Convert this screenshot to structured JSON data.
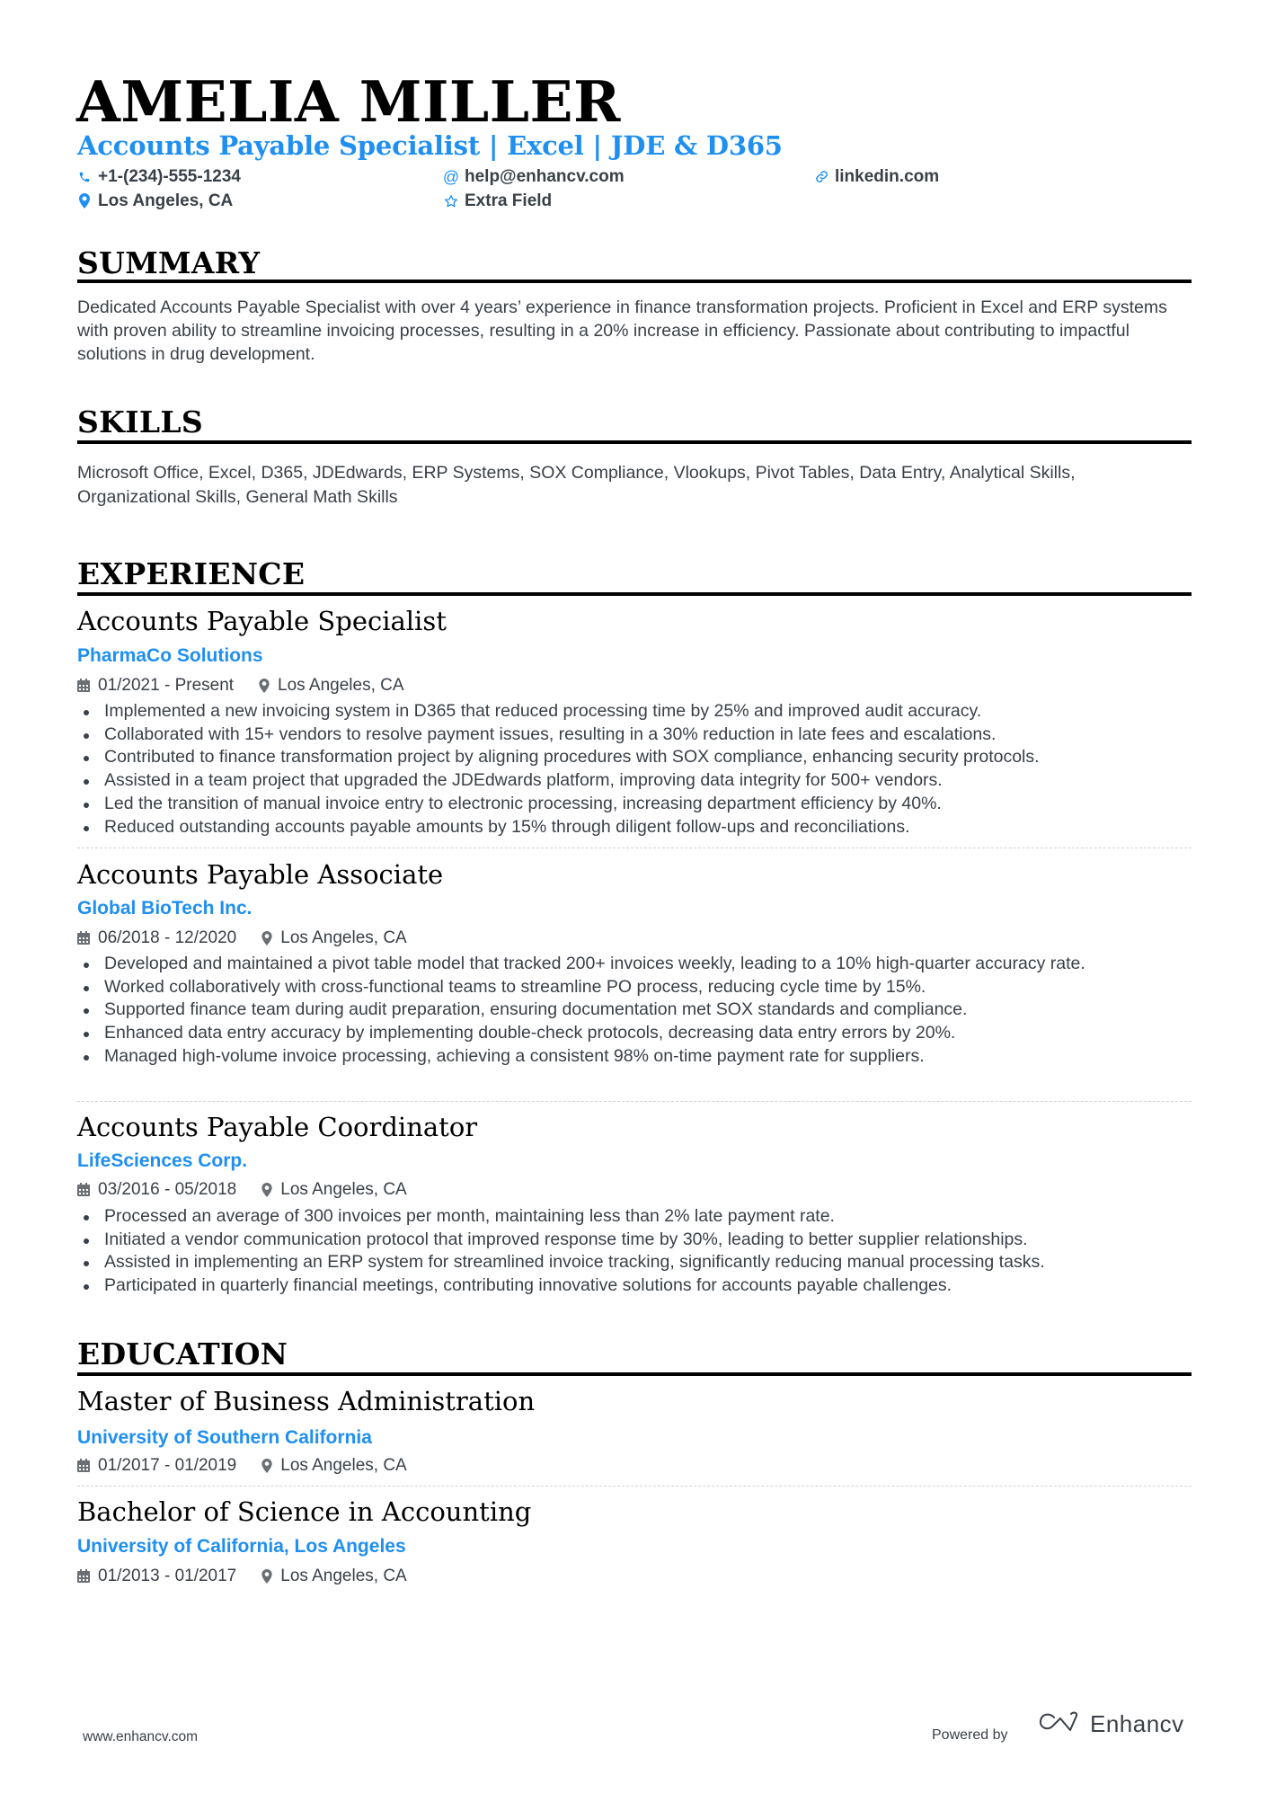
{
  "header": {
    "name": "AMELIA MILLER",
    "subtitle": "Accounts Payable Specialist | Excel | JDE & D365",
    "contacts": {
      "phone": {
        "icon": "phone-icon",
        "text": "+1-(234)-555-1234"
      },
      "email": {
        "icon": "at-icon",
        "text": "help@enhancv.com"
      },
      "linkedin": {
        "icon": "link-icon",
        "text": "linkedin.com"
      },
      "location": {
        "icon": "location-pin-icon",
        "text": "Los Angeles, CA"
      },
      "extra": {
        "icon": "star-icon",
        "text": "Extra Field"
      }
    }
  },
  "summary": {
    "heading": "SUMMARY",
    "text": "Dedicated Accounts Payable Specialist with over 4 years’ experience in finance transformation projects. Proficient in Excel and ERP systems with proven ability to streamline invoicing processes, resulting in a 20% increase in efficiency. Passionate about contributing to impactful solutions in drug development."
  },
  "skills": {
    "heading": "SKILLS",
    "text": "Microsoft Office, Excel, D365, JDEdwards, ERP Systems, SOX Compliance, Vlookups, Pivot Tables, Data Entry, Analytical Skills, Organizational Skills, General Math Skills"
  },
  "experience": {
    "heading": "EXPERIENCE",
    "jobs": [
      {
        "title": "Accounts Payable Specialist",
        "company": "PharmaCo Solutions",
        "dates": "01/2021 - Present",
        "location": "Los Angeles, CA",
        "bullets": [
          "Implemented a new invoicing system in D365 that reduced processing time by 25% and improved audit accuracy.",
          "Collaborated with 15+ vendors to resolve payment issues, resulting in a 30% reduction in late fees and escalations.",
          "Contributed to finance transformation project by aligning procedures with SOX compliance, enhancing security protocols.",
          "Assisted in a team project that upgraded the JDEdwards platform, improving data integrity for 500+ vendors.",
          "Led the transition of manual invoice entry to electronic processing, increasing department efficiency by 40%.",
          "Reduced outstanding accounts payable amounts by 15% through diligent follow-ups and reconciliations."
        ]
      },
      {
        "title": "Accounts Payable Associate",
        "company": "Global BioTech Inc.",
        "dates": "06/2018 - 12/2020",
        "location": "Los Angeles, CA",
        "bullets": [
          "Developed and maintained a pivot table model that tracked 200+ invoices weekly, leading to a 10% high-quarter accuracy rate.",
          "Worked collaboratively with cross-functional teams to streamline PO process, reducing cycle time by 15%.",
          "Supported finance team during audit preparation, ensuring documentation met SOX standards and compliance.",
          "Enhanced data entry accuracy by implementing double-check protocols, decreasing data entry errors by 20%.",
          "Managed high-volume invoice processing, achieving a consistent 98% on-time payment rate for suppliers."
        ]
      },
      {
        "title": "Accounts Payable Coordinator",
        "company": "LifeSciences Corp.",
        "dates": "03/2016 - 05/2018",
        "location": "Los Angeles, CA",
        "bullets": [
          "Processed an average of 300 invoices per month, maintaining less than 2% late payment rate.",
          "Initiated a vendor communication protocol that improved response time by 30%, leading to better supplier relationships.",
          "Assisted in implementing an ERP system for streamlined invoice tracking, significantly reducing manual processing tasks.",
          "Participated in quarterly financial meetings, contributing innovative solutions for accounts payable challenges."
        ]
      }
    ]
  },
  "education": {
    "heading": "EDUCATION",
    "items": [
      {
        "degree": "Master of Business Administration",
        "school": "University of Southern California",
        "dates": "01/2017 - 01/2019",
        "location": "Los Angeles, CA"
      },
      {
        "degree": "Bachelor of Science in Accounting",
        "school": "University of California, Los Angeles",
        "dates": "01/2013 - 01/2017",
        "location": "Los Angeles, CA"
      }
    ]
  },
  "footer": {
    "url": "www.enhancv.com",
    "powered_by": "Powered by",
    "brand": "Enhancv"
  },
  "colors": {
    "accent": "#1f8ff0",
    "text": "#3a4048",
    "heading": "#000000"
  }
}
